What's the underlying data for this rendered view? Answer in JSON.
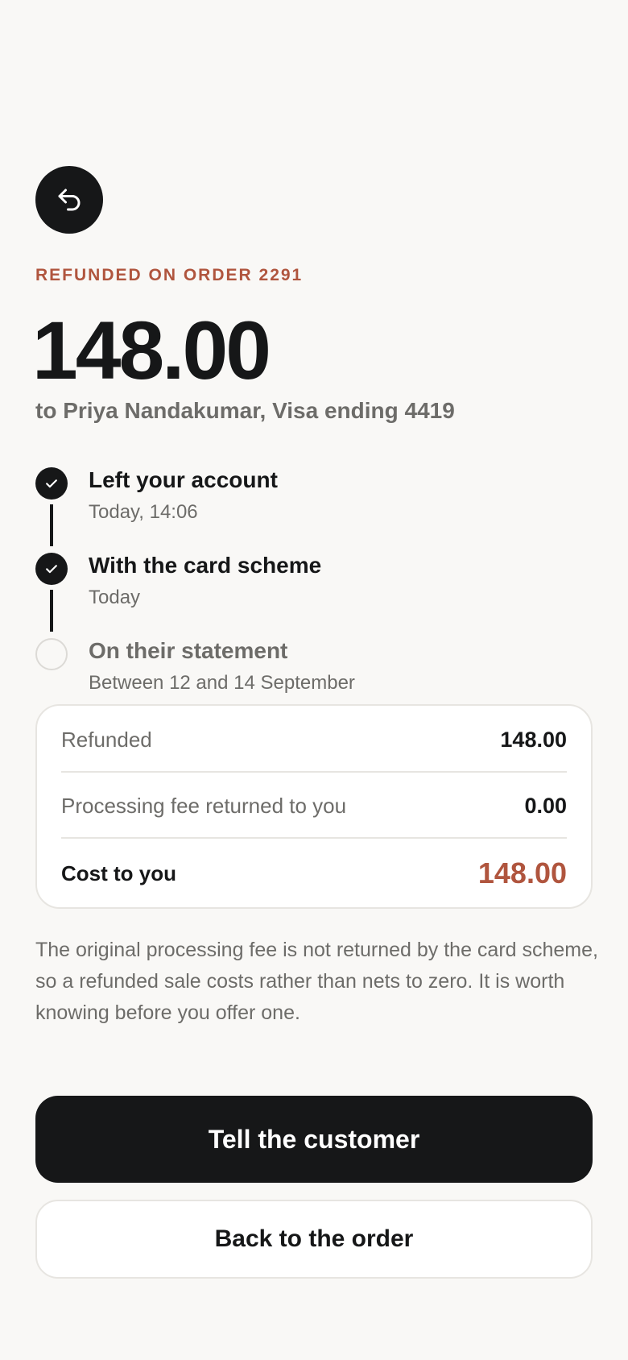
{
  "header": {
    "back_icon": "return-arrow-icon",
    "eyebrow": "REFUNDED ON ORDER 2291",
    "amount": "148.00",
    "recipient": "to Priya Nandakumar, Visa ending 4419"
  },
  "timeline": {
    "steps": [
      {
        "title": "Left your account",
        "subtitle": "Today, 14:06",
        "status": "done"
      },
      {
        "title": "With the card scheme",
        "subtitle": "Today",
        "status": "done"
      },
      {
        "title": "On their statement",
        "subtitle": "Between 12 and 14 September",
        "status": "pending"
      }
    ]
  },
  "summary": {
    "rows": [
      {
        "label": "Refunded",
        "value": "148.00"
      },
      {
        "label": "Processing fee returned to you",
        "value": "0.00"
      }
    ],
    "total": {
      "label": "Cost to you",
      "value": "148.00"
    }
  },
  "note": "The original processing fee is not returned by the card scheme, so a refunded sale costs rather than nets to zero. It is worth knowing before you offer one.",
  "actions": {
    "primary_label": "Tell the customer",
    "secondary_label": "Back to the order"
  },
  "colors": {
    "accent": "#b0553e",
    "ink": "#161718",
    "muted": "#6d6c69",
    "background": "#f9f8f6"
  }
}
